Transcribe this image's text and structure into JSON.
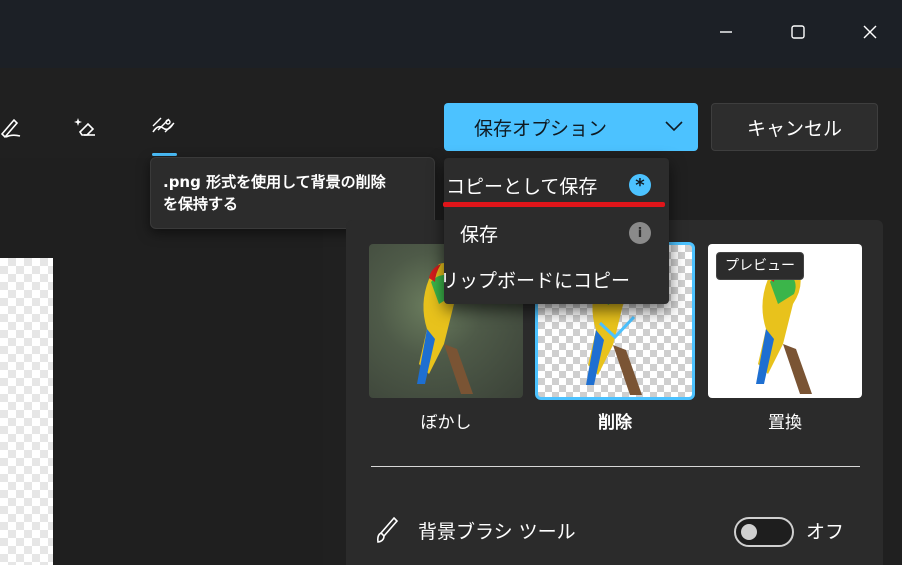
{
  "toolbar": {
    "save_label": "保存オプション",
    "cancel_label": "キャンセル"
  },
  "tooltip": {
    "line1": ".png 形式を使用して背景の削除",
    "line2": "を保持する"
  },
  "save_menu": {
    "items": [
      {
        "label": "コピーとして保存",
        "badge": "*"
      },
      {
        "label": "保存",
        "badge": "i"
      },
      {
        "label": "リップボードにコピー"
      }
    ]
  },
  "background_options": {
    "options": [
      {
        "label": "ぼかし"
      },
      {
        "label": "削除",
        "selected": true
      },
      {
        "label": "置換"
      }
    ],
    "preview_tooltip": "プレビュー"
  },
  "brush_tool": {
    "label": "背景ブラシ ツール",
    "toggle_state": "オフ",
    "enabled": false
  },
  "colors": {
    "accent": "#4cc2ff",
    "highlight_underline": "#e0151a",
    "background": "#202020"
  }
}
